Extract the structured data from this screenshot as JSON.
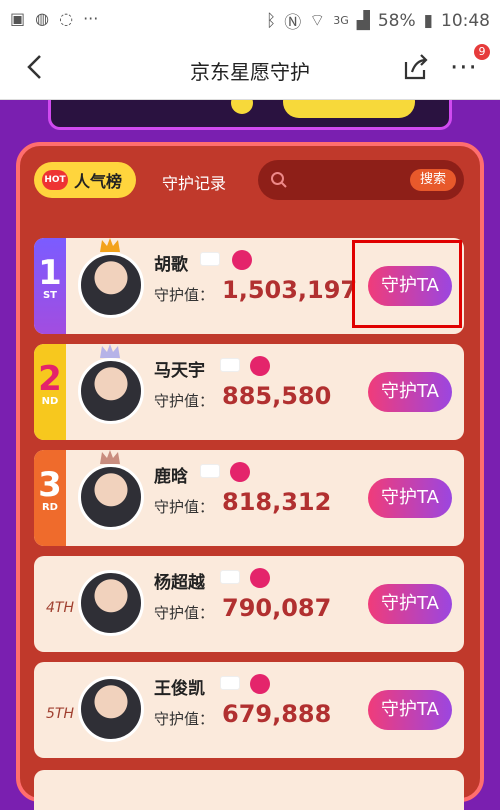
{
  "status_bar": {
    "signal": "3G",
    "battery": "58%",
    "time": "10:48"
  },
  "header": {
    "title": "京东星愿守护",
    "badge_count": "9"
  },
  "tabs": {
    "hot_badge": "HOT",
    "popularity": "人气榜",
    "record": "守护记录"
  },
  "search": {
    "placeholder": "",
    "button": "搜索"
  },
  "guard_label": "守护值：",
  "guard_button": "守护TA",
  "ranking": [
    {
      "rank": "1",
      "suffix": "ST",
      "name": "胡歌",
      "value": "1,503,197"
    },
    {
      "rank": "2",
      "suffix": "ND",
      "name": "马天宇",
      "value": "885,580"
    },
    {
      "rank": "3",
      "suffix": "RD",
      "name": "鹿晗",
      "value": "818,312"
    },
    {
      "rank": "4TH",
      "name": "杨超越",
      "value": "790,087"
    },
    {
      "rank": "5TH",
      "name": "王俊凯",
      "value": "679,888"
    }
  ],
  "colors": {
    "accent": "#e00000",
    "panel": "#c0392b",
    "row_bg": "#fbeadc"
  }
}
